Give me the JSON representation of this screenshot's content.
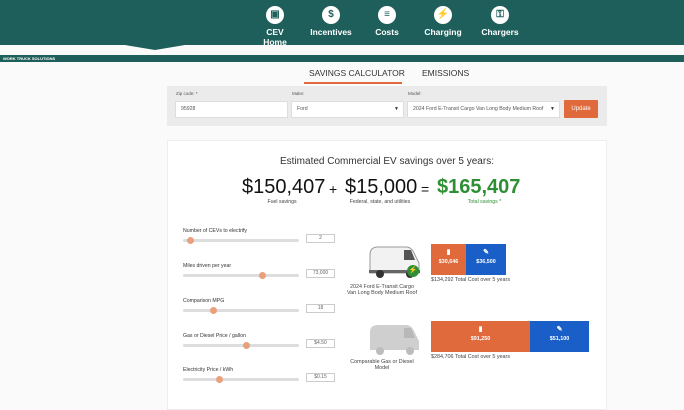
{
  "nav": {
    "items": [
      {
        "label": "CEV Home",
        "icon": "truck-icon"
      },
      {
        "label": "Incentives",
        "icon": "money-icon"
      },
      {
        "label": "Costs",
        "icon": "document-icon"
      },
      {
        "label": "Charging",
        "icon": "charging-station-icon"
      },
      {
        "label": "Chargers",
        "icon": "charger-icon"
      }
    ]
  },
  "brand": "WORK TRUCK SOLUTIONS",
  "tabs": [
    {
      "label": "SAVINGS CALCULATOR",
      "active": true
    },
    {
      "label": "EMISSIONS",
      "active": false
    }
  ],
  "form": {
    "zip_label": "Zip code: *",
    "zip_value": "95928",
    "make_label": "Make:",
    "make_value": "Ford",
    "model_label": "Model:",
    "model_value": "2024 Ford E-Transit Cargo Van Long Body Medium Roof",
    "update_label": "Update"
  },
  "results": {
    "headline": "Estimated Commercial EV savings over 5 years:",
    "fuel_savings": "$150,407",
    "fuel_caption": "Fuel savings",
    "plus": "+",
    "incentives": "$15,000",
    "incentives_caption": "Federal, state, and utilities",
    "equals": "=",
    "total": "$165,407",
    "total_caption": "Total savings *"
  },
  "sliders": [
    {
      "label": "Number of CEVs to electrify",
      "value": "2",
      "fraction": 0.04
    },
    {
      "label": "Miles driven per year",
      "value": "73,000",
      "fraction": 0.7
    },
    {
      "label": "Comparison MPG",
      "value": "18",
      "fraction": 0.25
    },
    {
      "label": "Gas or Diesel Price / gallon",
      "value": "$4.50",
      "fraction": 0.55
    },
    {
      "label": "Electricity Price / kWh",
      "value": "$0.15",
      "fraction": 0.3
    }
  ],
  "ev": {
    "caption": "2024 Ford E-Transit Cargo Van Long Body Medium Roof",
    "fuel_cost": "$30,646",
    "maintenance_cost": "$36,500",
    "total_text": "$134,292 Total Cost over 5 years"
  },
  "gas": {
    "caption": "Comparable Gas or Diesel Model",
    "fuel_cost": "$91,250",
    "maintenance_cost": "$51,100",
    "total_text": "$284,706 Total Cost over 5 years"
  },
  "colors": {
    "header": "#1f5f5b",
    "accent": "#e06a3b",
    "blue": "#1a5fc7",
    "green": "#2f8f34"
  }
}
